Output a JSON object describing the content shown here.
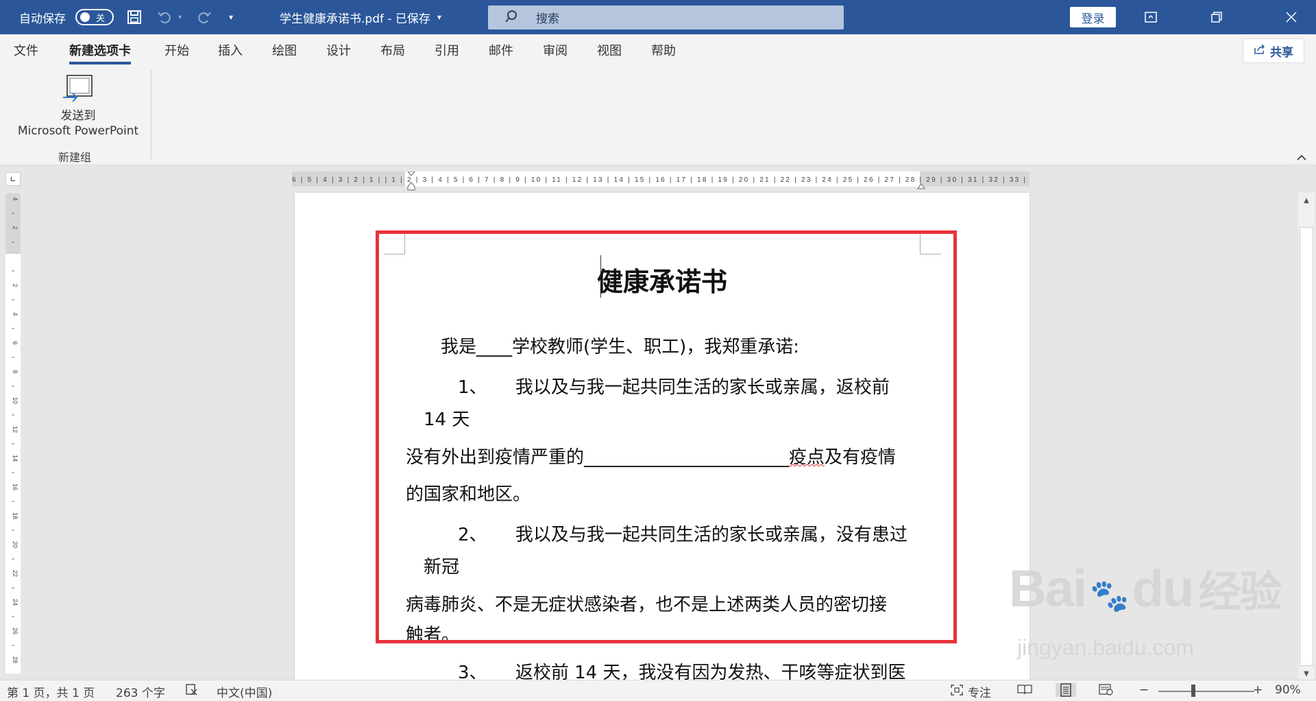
{
  "titlebar": {
    "autosave_label": "自动保存",
    "autosave_state": "关",
    "doc_title": "学生健康承诺书.pdf - 已保存",
    "search_placeholder": "搜索",
    "login": "登录",
    "bg_color": "#2b579a"
  },
  "tabs": [
    "文件",
    "新建选项卡",
    "开始",
    "插入",
    "绘图",
    "设计",
    "布局",
    "引用",
    "邮件",
    "审阅",
    "视图",
    "帮助"
  ],
  "active_tab": "新建选项卡",
  "share": "共享",
  "ribbon": {
    "button_line1": "发送到",
    "button_line2": "Microsoft PowerPoint",
    "group_label": "新建组"
  },
  "ruler": {
    "h_labels": "6 | 5 | 4 | 3 | 2 | 1 |    |  1 | 2 | 3 | 4 | 5 | 6 | 7 | 8 | 9 | 10 | 11 | 12 | 13 | 14 | 15 | 16 | 17 | 18 | 19 | 20 | 21 | 22 | 23 | 24 | 25 | 26 | 27 | 28 | 29 | 30 | 31 | 32 | 33 |",
    "v_labels": [
      "4",
      "2",
      "",
      "2",
      "4",
      "6",
      "8",
      "10",
      "12",
      "14",
      "16",
      "18",
      "20",
      "22",
      "24",
      "26",
      "28"
    ]
  },
  "document": {
    "title": "健康承诺书",
    "lines": [
      "我是____学校教师(学生、职工)，我郑重承诺:",
      "1、     我以及与我一起共同生活的家长或亲属，返校前",
      "14 天",
      "没有外出到疫情严重的_______________________",
      "疫点",
      "及有疫情",
      "的国家和地区。",
      "2、     我以及与我一起共同生活的家长或亲属，没有患过",
      "新冠",
      "病毒肺炎、不是无症状感染者，也不是上述两类人员的密切接",
      "触者。",
      "3、     返校前 14 天，我没有因为发热、干咳等症状到医"
    ]
  },
  "status": {
    "page": "第 1 页，共 1 页",
    "words": "263 个字",
    "language": "中文(中国)",
    "focus": "专注",
    "zoom": "90%",
    "zoom_minus": "−",
    "zoom_plus": "+"
  },
  "watermark": {
    "brand": "Bai",
    "brand2": "du",
    "cn": "经验",
    "url": "jingyan.baidu.com"
  },
  "colors": {
    "highlight_box": "#e8323c",
    "accent": "#2b579a"
  }
}
